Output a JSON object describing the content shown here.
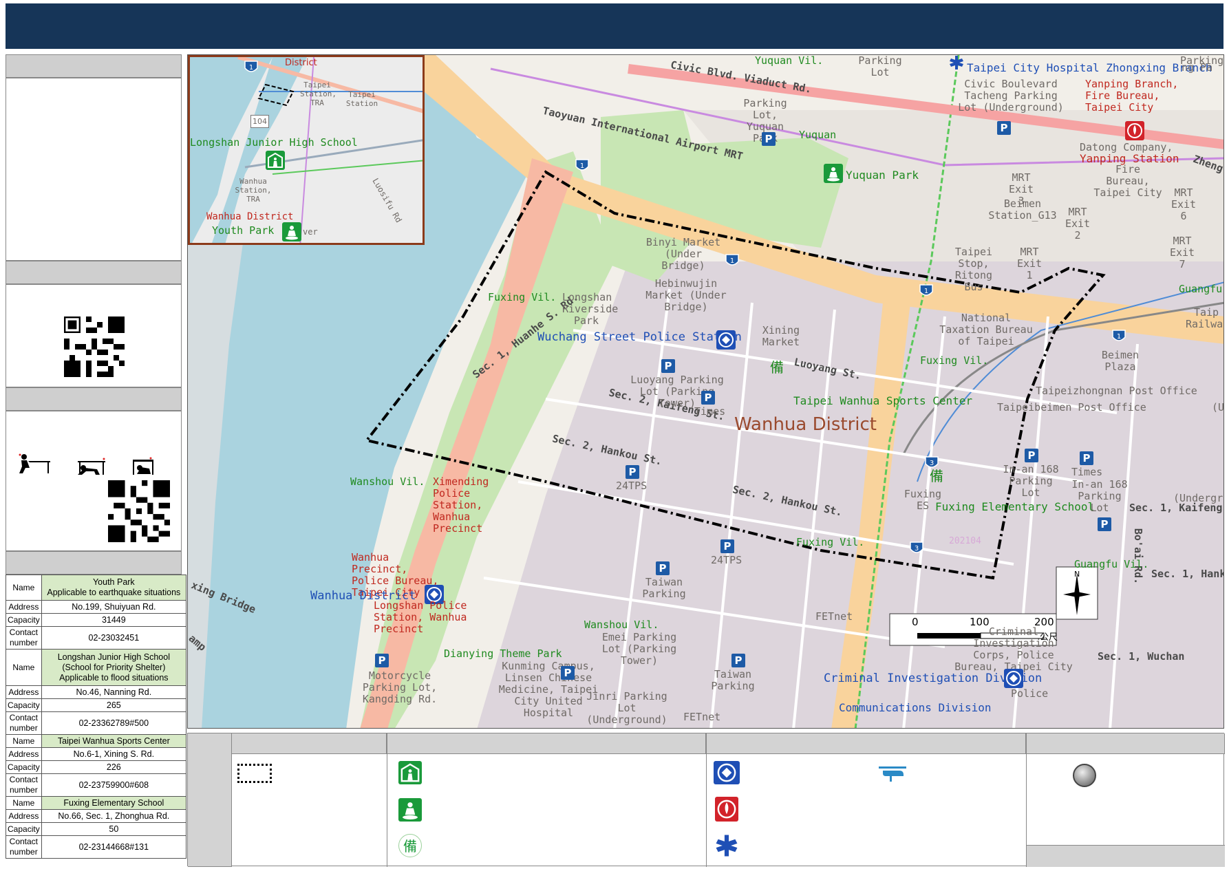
{
  "map": {
    "district_label": "Wanhua District",
    "roads": {
      "civic_blvd": "Civic Blvd. Viaduct Rd.",
      "taoyuan_mrt": "Taoyuan International Airport MRT",
      "huanhe": "Sec. 1, Huanhe S. Rd.",
      "kaifeng": "Sec. 2, Kaifeng St.",
      "hankou_a": "Sec. 2, Hankou St.",
      "hankou_b": "Sec. 2, Hankou St.",
      "luoyang": "Luoyang St.",
      "zheng": "Zheng",
      "guangfu": "Guangfu",
      "kaifeng1": "Sec. 1, Kaifeng S",
      "hank1": "Sec. 1, Hank",
      "wuchan": "Sec. 1, Wuchan",
      "boai": "Bo'ai Rd.",
      "bridge": "xing Bridge",
      "ramp": "amp",
      "hw_1": "1",
      "hw_3": "3"
    },
    "places": {
      "yuquan_vil": "Yuquan Vil.",
      "parking_lot_top": "Parking Lot",
      "hospital": "Taipei City Hospital Zhongxing Branch",
      "parking_lot_tr": "Parking Lot",
      "ng_pa": "ng Pa",
      "civic_parking": "Civic Boulevard Tacheng Parking Lot (Underground)",
      "yanping_fire": "Yanping Branch, Fire Bureau, Taipei City",
      "yuquan_parking": "Parking Lot, Yuquan Park",
      "yuquan_small": "Yuquan",
      "yuquan_park": "Yuquan Park",
      "datong": "Datong Company,",
      "yanping_station": "Yanping Station",
      "fire_bureau": "Fire Bureau, Taipei City",
      "mrt_exit3": "MRT Exit 3",
      "beimen": "Beimen Station_G13",
      "mrt_exit2": "MRT Exit 2",
      "mrt_exit6": "MRT Exit 6",
      "mrt_exit7": "MRT Exit 7",
      "binyi": "Binyi Market (Under Bridge)",
      "hebinwujin": "Hebinwujin Market (Under Bridge)",
      "taipei_stop": "Taipei Stop, Ritong Bus",
      "mrt_exit1": "MRT Exit 1",
      "fuxing_vil_l": "Fuxing Vil.",
      "longshan_park": "Longshan Riverside Park",
      "taipei_rail": "Taip Railway",
      "taxation": "National Taxation Bureau of Taipei",
      "wuchang_police": "Wuchang Street Police Station",
      "xining": "Xining Market",
      "fuxing_vil_r": "Fuxing Vil.",
      "beimen_plaza": "Beimen Plaza",
      "luoyang_parking": "Luoyang Parking Lot (Parking Tower)",
      "times": "Times",
      "sports_center": "Taipei Wanhua Sports Center",
      "zhongnan_post": "Taipeizhongnan Post Office",
      "beimen_post": "Taipeibeimen Post Office",
      "u_label": "(U",
      "wanshou_vil": "Wanshou Vil.",
      "ximending": "Ximending Police Station, Wanhua Precinct",
      "tps24_a": "24TPS",
      "fuxing_es": "Fuxing ES",
      "fuxing_school": "Fuxing Elementary School",
      "inan_parking": "In-an 168 Parking Lot",
      "times2": "Times",
      "inan2": "In-an 168 Parking Lot",
      "underground_r": "(Undergr",
      "wanhua_precinct": "Wanhua Precinct, Police Bureau, Taipei City",
      "fuxing_vil_c": "Fuxing Vil.",
      "tps24_b": "24TPS",
      "guangfu_vil": "Guangfu Vil.",
      "taiwan_parking": "Taiwan Parking",
      "wanhua_district_police": "Wanhua District",
      "longshan_police": "Longshan Police Station, Wanhua Precinct",
      "fetnet_a": "FETnet",
      "wanshou_vil2": "Wanshou Vil.",
      "emei": "Emei Parking Lot (Parking Tower)",
      "criminal_corps": "Criminal Investigation Corps, Police Bureau, Taipei City",
      "dianying": "Dianying Theme Park",
      "kunming": "Kunming Campus, Linsen Chinese Medicine, Taipei City United Hospital",
      "motorcycle": "Motorcycle Parking Lot, Kangding Rd.",
      "taiwan_parking2": "Taiwan Parking",
      "criminal_div": "Criminal Investigation Division",
      "jinri": "Jinri Parking Lot (Underground)",
      "fetnet_b": "FETnet",
      "comm_div": "Communications Division",
      "police_small": "Police",
      "watermark": "202104"
    },
    "inset": {
      "district": "District",
      "taipei_station_tra": "Taipei Station, TRA",
      "taipei_station": "Taipei Station",
      "road_104": "104",
      "longshan_jhs": "Longshan Junior High School",
      "wanhua_station": "Wanhua Station, TRA",
      "wanhua_district": "Wanhua District",
      "youth_park": "Youth Park",
      "luosifu": "Luosifu Rd",
      "river": "ver",
      "hw_1": "1"
    },
    "scale": {
      "t0": "0",
      "t100": "100",
      "t200": "200",
      "unit": "公尺"
    },
    "north": "N",
    "parking_symbol": "P",
    "standby_symbol": "備"
  },
  "shelters": [
    {
      "name_lines": [
        "Youth Park",
        "Applicable to earthquake situations"
      ],
      "address": "No.199, Shuiyuan Rd.",
      "capacity": "31449",
      "contact": "02-23032451"
    },
    {
      "name_lines": [
        "Longshan Junior High School",
        "(School for Priority Shelter)",
        "Applicable to flood situations"
      ],
      "address": "No.46, Nanning Rd.",
      "capacity": "265",
      "contact": "02-23362789#500"
    },
    {
      "name_lines": [
        "Taipei Wanhua Sports Center"
      ],
      "address": "No.6-1, Xining S. Rd.",
      "capacity": "226",
      "contact": "02-23759900#608"
    },
    {
      "name_lines": [
        "Fuxing Elementary School"
      ],
      "address": "No.66, Sec. 1, Zhonghua Rd.",
      "capacity": "50",
      "contact": "02-23144668#131"
    }
  ],
  "table_keys": {
    "name": "Name",
    "address": "Address",
    "capacity": "Capacity",
    "contact_1": "Contact",
    "contact_2": "number"
  },
  "colors": {
    "title_bar": "#163558",
    "river": "#aad3df",
    "highway": "#f9b29c",
    "park": "#c8e6b4",
    "shelter_green": "#1a9a3a",
    "police_blue": "#1f4fb5",
    "fire_red": "#d2232a"
  },
  "legend_icons": [
    "boundary-icon",
    "shelter-icon",
    "park-shelter-icon",
    "standby-shelter-icon",
    "police-icon",
    "fire-station-icon",
    "hospital-icon",
    "helicopter-icon",
    "gathering-point-icon"
  ]
}
